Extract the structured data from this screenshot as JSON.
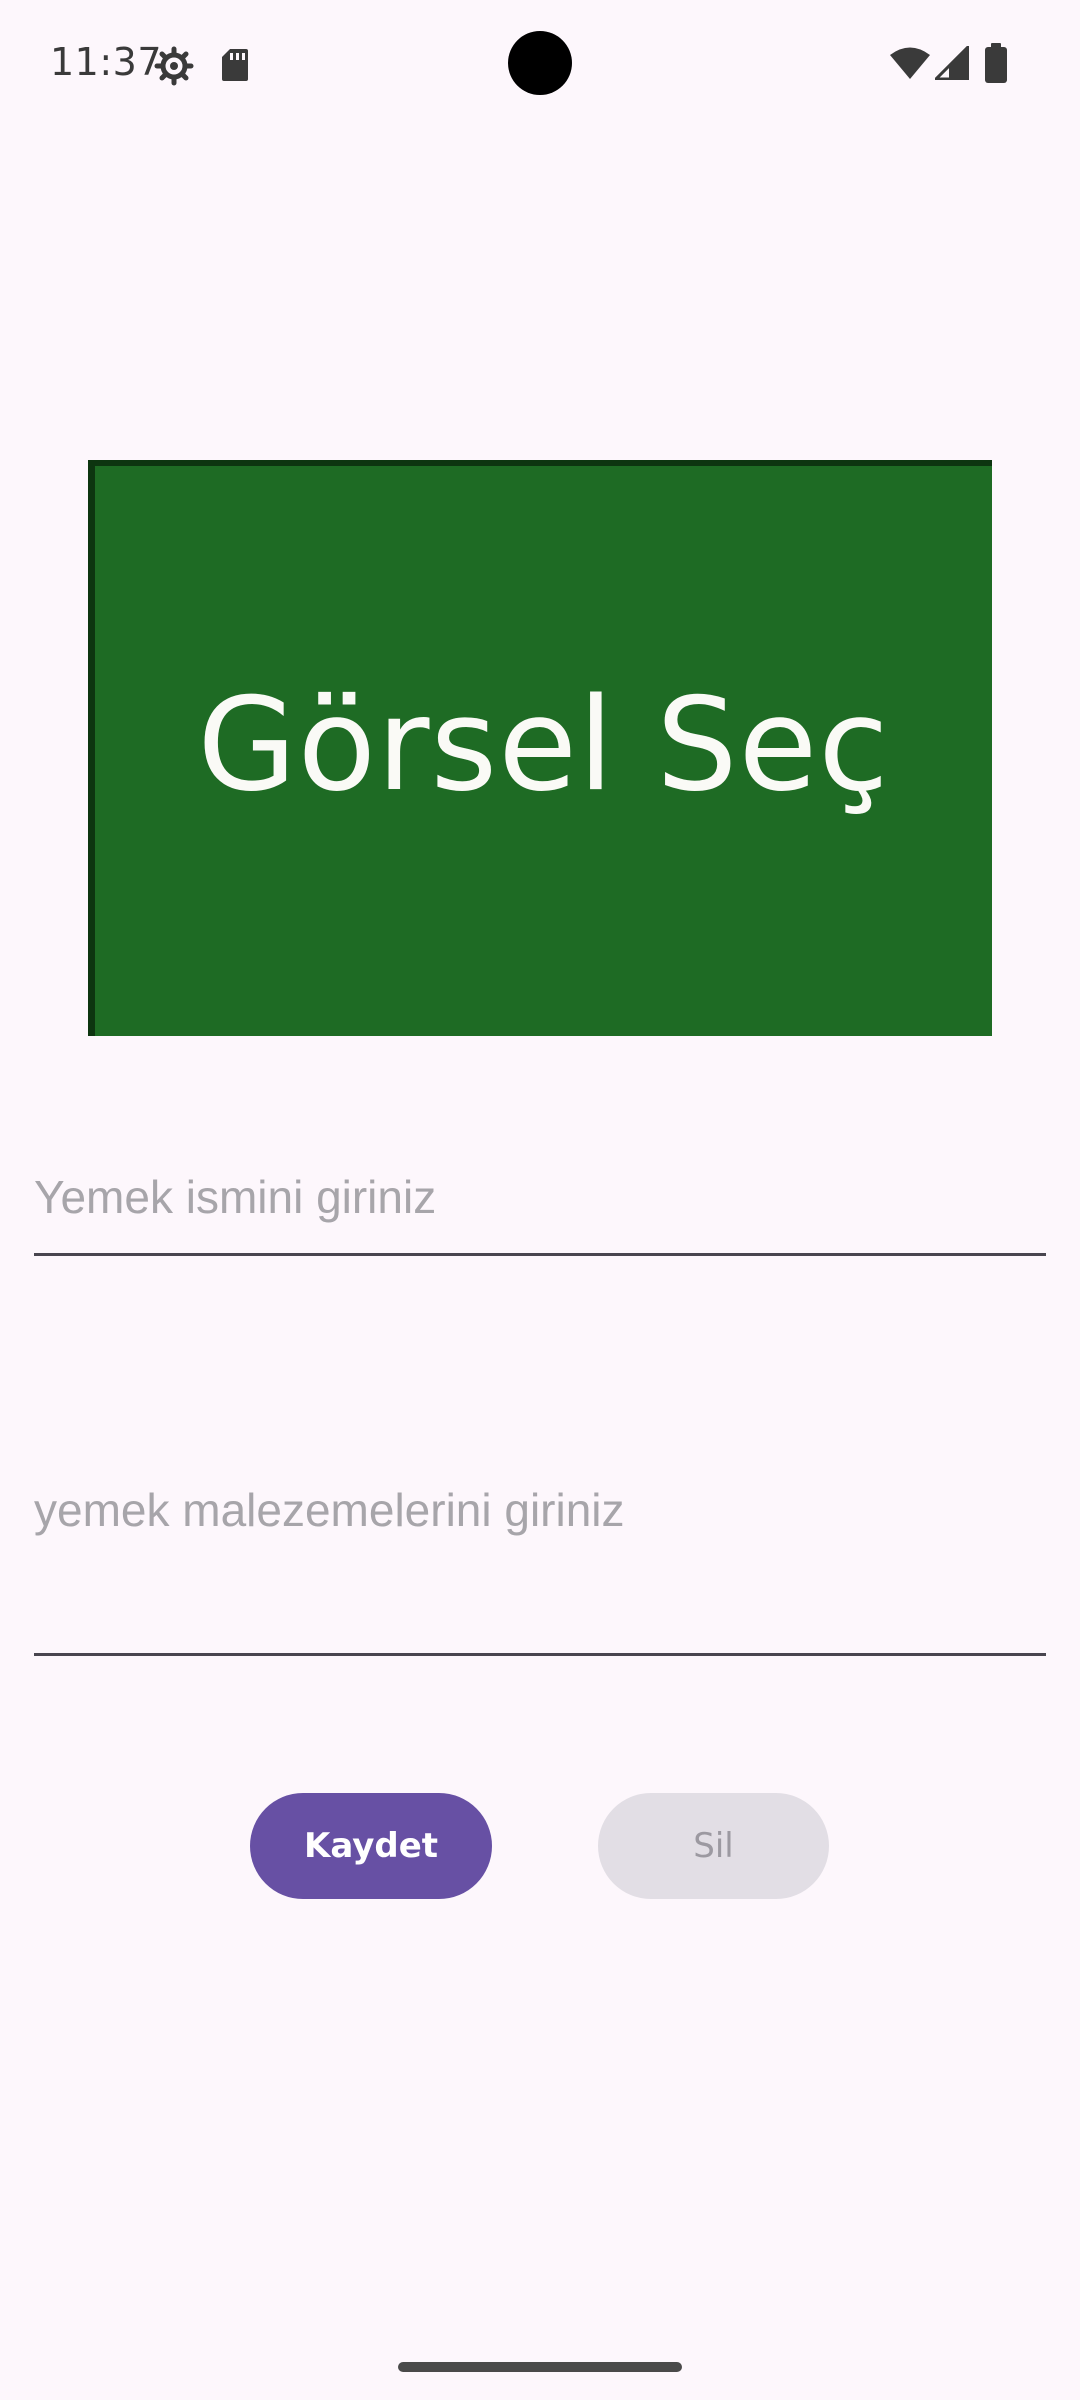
{
  "status_bar": {
    "time": "11:37",
    "left_icons": [
      "settings-gear-icon",
      "sd-card-icon"
    ],
    "right_icons": [
      "wifi-icon",
      "cell-signal-icon",
      "battery-icon"
    ]
  },
  "image_picker": {
    "label": "Görsel Seç",
    "background_color": "#1E6B24"
  },
  "form": {
    "name_placeholder": "Yemek ismini giriniz",
    "name_value": "",
    "ingredients_placeholder": "yemek malezemelerini giriniz",
    "ingredients_value": ""
  },
  "actions": {
    "save_label": "Kaydet",
    "delete_label": "Sil",
    "save_color": "#6750A4",
    "delete_enabled": false
  }
}
